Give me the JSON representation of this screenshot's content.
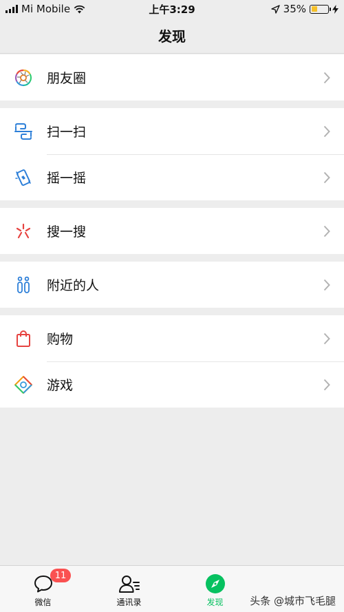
{
  "status_bar": {
    "carrier": "Mi Mobile",
    "time": "上午3:29",
    "battery_percent": "35%",
    "battery_level": 0.35,
    "battery_color": "#f5c02a"
  },
  "nav": {
    "title": "发现"
  },
  "groups": [
    [
      {
        "label": "朋友圈",
        "icon": "moments-icon"
      }
    ],
    [
      {
        "label": "扫一扫",
        "icon": "scan-icon"
      },
      {
        "label": "摇一摇",
        "icon": "shake-icon"
      }
    ],
    [
      {
        "label": "搜一搜",
        "icon": "search-icon"
      }
    ],
    [
      {
        "label": "附近的人",
        "icon": "nearby-people-icon"
      }
    ],
    [
      {
        "label": "购物",
        "icon": "shopping-bag-icon"
      },
      {
        "label": "游戏",
        "icon": "game-icon"
      }
    ]
  ],
  "tab_bar": {
    "tabs": [
      {
        "label": "微信",
        "icon": "chat-bubble-icon",
        "badge": "11",
        "active": false
      },
      {
        "label": "通讯录",
        "icon": "contacts-icon",
        "active": false
      },
      {
        "label": "发现",
        "icon": "compass-icon",
        "active": true
      }
    ],
    "accent_color": "#07c160"
  },
  "watermark": "头条 @城市飞毛腿"
}
